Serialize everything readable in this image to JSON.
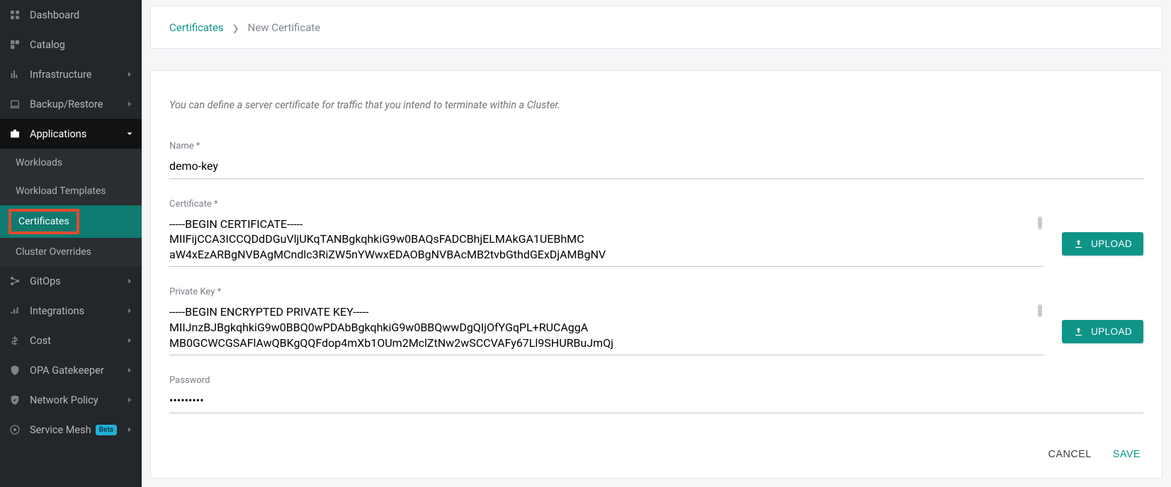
{
  "sidebar": {
    "dashboard": "Dashboard",
    "catalog": "Catalog",
    "infrastructure": "Infrastructure",
    "backup_restore": "Backup/Restore",
    "applications": "Applications",
    "workloads": "Workloads",
    "workload_templates": "Workload Templates",
    "certificates": "Certificates",
    "cluster_overrides": "Cluster Overrides",
    "gitops": "GitOps",
    "integrations": "Integrations",
    "cost": "Cost",
    "opa_gatekeeper": "OPA Gatekeeper",
    "network_policy": "Network Policy",
    "service_mesh": "Service Mesh",
    "beta_badge": "Beta"
  },
  "breadcrumb": {
    "root": "Certificates",
    "current": "New Certificate"
  },
  "form": {
    "helper": "You can define a server certificate for traffic that you intend to terminate within a Cluster.",
    "name_label": "Name *",
    "name_value": "demo-key",
    "certificate_label": "Certificate *",
    "certificate_value": "-----BEGIN CERTIFICATE-----\nMIIFijCCA3ICCQDdDGuVljUKqTANBgkqhkiG9w0BAQsFADCBhjELMAkGA1UEBhMC\naW4xEzARBgNVBAgMCndlc3RiZW5nYWwxEDAOBgNVBAcMB2tvbGthdGExDjAMBgNV",
    "private_key_label": "Private Key *",
    "private_key_value": "-----BEGIN ENCRYPTED PRIVATE KEY-----\nMIIJnzBJBgkqhkiG9w0BBQ0wPDAbBgkqhkiG9w0BBQwwDgQIjOfYGqPL+RUCAggA\nMB0GCWCGSAFlAwQBKgQQFdop4mXb1OUm2MclZtNw2wSCCVAFy67Ll9SHURBuJmQj",
    "password_label": "Password",
    "password_value": "•••••••••",
    "upload_label": "UPLOAD"
  },
  "actions": {
    "cancel": "CANCEL",
    "save": "SAVE"
  }
}
